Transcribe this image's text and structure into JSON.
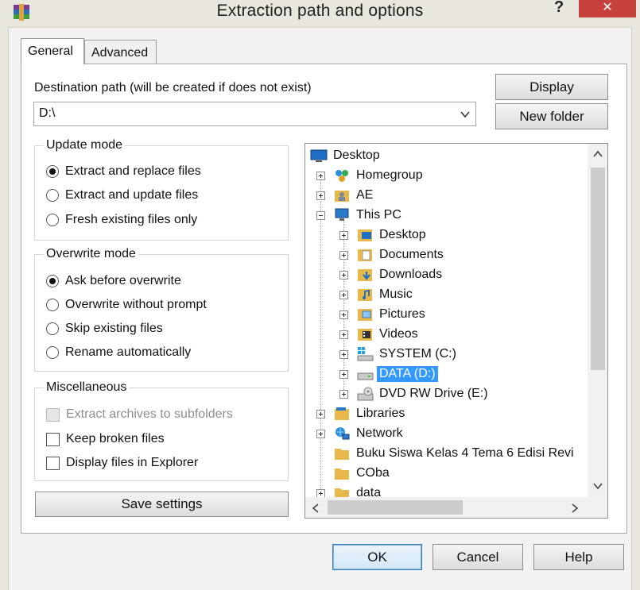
{
  "window": {
    "title": "Extraction path and options",
    "help_glyph": "?",
    "close_glyph": "✕"
  },
  "tabs": [
    {
      "label": "General"
    },
    {
      "label": "Advanced"
    }
  ],
  "destination": {
    "label": "Destination path (will be created if does not exist)",
    "value": "D:\\"
  },
  "buttons": {
    "display": "Display",
    "new_folder": "New folder",
    "save_settings": "Save settings",
    "ok": "OK",
    "cancel": "Cancel",
    "help": "Help"
  },
  "update_mode": {
    "title": "Update mode",
    "options": [
      "Extract and replace files",
      "Extract and update files",
      "Fresh existing files only"
    ],
    "selected_index": 0
  },
  "overwrite_mode": {
    "title": "Overwrite mode",
    "options": [
      "Ask before overwrite",
      "Overwrite without prompt",
      "Skip existing files",
      "Rename automatically"
    ],
    "selected_index": 0
  },
  "misc": {
    "title": "Miscellaneous",
    "options": [
      {
        "label": "Extract archives to subfolders",
        "checked": false,
        "disabled": true
      },
      {
        "label": "Keep broken files",
        "checked": false,
        "disabled": false
      },
      {
        "label": "Display files in Explorer",
        "checked": false,
        "disabled": false
      }
    ]
  },
  "tree": {
    "items": [
      {
        "label": "Desktop",
        "icon": "desktop-icon"
      },
      {
        "label": "Homegroup",
        "icon": "homegroup-icon"
      },
      {
        "label": "AE",
        "icon": "user-folder-icon"
      },
      {
        "label": "This PC",
        "icon": "computer-icon"
      },
      {
        "label": "Desktop",
        "icon": "folder-desktop-icon"
      },
      {
        "label": "Documents",
        "icon": "documents-icon"
      },
      {
        "label": "Downloads",
        "icon": "downloads-icon"
      },
      {
        "label": "Music",
        "icon": "music-icon"
      },
      {
        "label": "Pictures",
        "icon": "pictures-icon"
      },
      {
        "label": "Videos",
        "icon": "videos-icon"
      },
      {
        "label": "SYSTEM (C:)",
        "icon": "system-drive-icon"
      },
      {
        "label": "DATA (D:)",
        "icon": "drive-icon",
        "selected": true
      },
      {
        "label": "DVD RW Drive (E:)",
        "icon": "dvd-drive-icon"
      },
      {
        "label": "Libraries",
        "icon": "libraries-icon"
      },
      {
        "label": "Network",
        "icon": "network-icon"
      },
      {
        "label": "Buku Siswa Kelas 4 Tema 6 Edisi Revi",
        "icon": "folder-icon"
      },
      {
        "label": "COba",
        "icon": "folder-icon"
      },
      {
        "label": "data",
        "icon": "folder-icon"
      }
    ]
  },
  "colors": {
    "selection": "#3399ff",
    "close_button": "#c7413c",
    "ok_border": "#3c7fb1"
  }
}
